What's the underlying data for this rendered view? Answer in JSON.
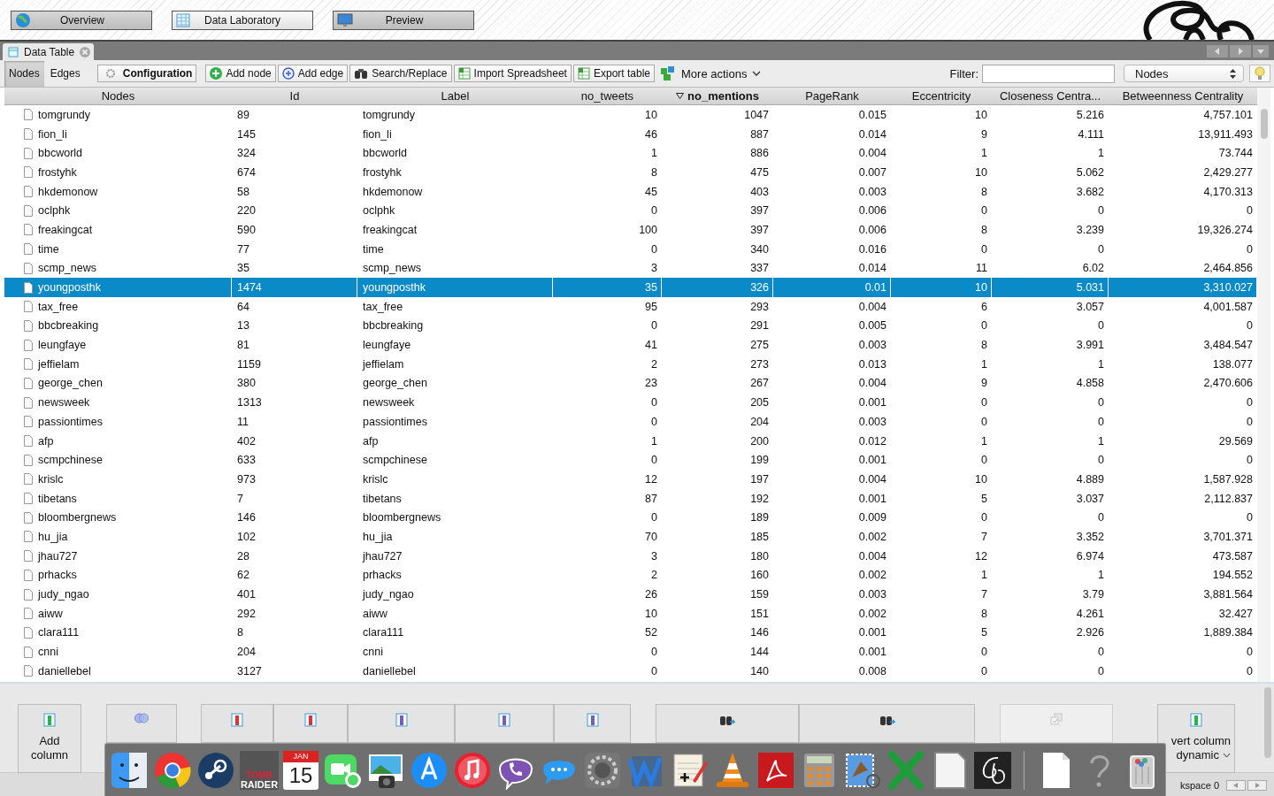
{
  "perspectives": [
    {
      "label": "Overview",
      "selected": false
    },
    {
      "label": "Data Laboratory",
      "selected": true
    },
    {
      "label": "Preview",
      "selected": false
    }
  ],
  "panel_tab": {
    "title": "Data Table"
  },
  "view_tabs": [
    {
      "label": "Nodes",
      "selected": true
    },
    {
      "label": "Edges",
      "selected": false
    }
  ],
  "toolbar": {
    "configuration": "Configuration",
    "actions": [
      "Add node",
      "Add edge",
      "Search/Replace",
      "Import Spreadsheet",
      "Export table"
    ],
    "more_actions": "More actions",
    "filter_label": "Filter:",
    "table_select": "Nodes"
  },
  "table": {
    "columns": [
      {
        "label": "Nodes",
        "kind": "text",
        "sorted": false
      },
      {
        "label": "Id",
        "kind": "text",
        "sorted": false
      },
      {
        "label": "Label",
        "kind": "text",
        "sorted": false
      },
      {
        "label": "no_tweets",
        "kind": "number",
        "sorted": false
      },
      {
        "label": "no_mentions",
        "kind": "number",
        "sorted": true
      },
      {
        "label": "PageRank",
        "kind": "number",
        "sorted": false
      },
      {
        "label": "Eccentricity",
        "kind": "number",
        "sorted": false
      },
      {
        "label": "Closeness Centra...",
        "kind": "number",
        "sorted": false
      },
      {
        "label": "Betweenness Centrality",
        "kind": "number",
        "sorted": false
      }
    ],
    "rows": [
      {
        "selected": false,
        "cells": [
          "tomgrundy",
          "89",
          "tomgrundy",
          "10",
          "1047",
          "0.015",
          "10",
          "5.216",
          "4,757.101"
        ]
      },
      {
        "selected": false,
        "cells": [
          "fion_li",
          "145",
          "fion_li",
          "46",
          "887",
          "0.014",
          "9",
          "4.111",
          "13,911.493"
        ]
      },
      {
        "selected": false,
        "cells": [
          "bbcworld",
          "324",
          "bbcworld",
          "1",
          "886",
          "0.004",
          "1",
          "1",
          "73.744"
        ]
      },
      {
        "selected": false,
        "cells": [
          "frostyhk",
          "674",
          "frostyhk",
          "8",
          "475",
          "0.007",
          "10",
          "5.062",
          "2,429.277"
        ]
      },
      {
        "selected": false,
        "cells": [
          "hkdemonow",
          "58",
          "hkdemonow",
          "45",
          "403",
          "0.003",
          "8",
          "3.682",
          "4,170.313"
        ]
      },
      {
        "selected": false,
        "cells": [
          "oclphk",
          "220",
          "oclphk",
          "0",
          "397",
          "0.006",
          "0",
          "0",
          "0"
        ]
      },
      {
        "selected": false,
        "cells": [
          "freakingcat",
          "590",
          "freakingcat",
          "100",
          "397",
          "0.006",
          "8",
          "3.239",
          "19,326.274"
        ]
      },
      {
        "selected": false,
        "cells": [
          "time",
          "77",
          "time",
          "0",
          "340",
          "0.016",
          "0",
          "0",
          "0"
        ]
      },
      {
        "selected": false,
        "cells": [
          "scmp_news",
          "35",
          "scmp_news",
          "3",
          "337",
          "0.014",
          "11",
          "6.02",
          "2,464.856"
        ]
      },
      {
        "selected": true,
        "cells": [
          "youngposthk",
          "1474",
          "youngposthk",
          "35",
          "326",
          "0.01",
          "10",
          "5.031",
          "3,310.027"
        ]
      },
      {
        "selected": false,
        "cells": [
          "tax_free",
          "64",
          "tax_free",
          "95",
          "293",
          "0.004",
          "6",
          "3.057",
          "4,001.587"
        ]
      },
      {
        "selected": false,
        "cells": [
          "bbcbreaking",
          "13",
          "bbcbreaking",
          "0",
          "291",
          "0.005",
          "0",
          "0",
          "0"
        ]
      },
      {
        "selected": false,
        "cells": [
          "leungfaye",
          "81",
          "leungfaye",
          "41",
          "275",
          "0.003",
          "8",
          "3.991",
          "3,484.547"
        ]
      },
      {
        "selected": false,
        "cells": [
          "jeffielam",
          "1159",
          "jeffielam",
          "2",
          "273",
          "0.013",
          "1",
          "1",
          "138.077"
        ]
      },
      {
        "selected": false,
        "cells": [
          "george_chen",
          "380",
          "george_chen",
          "23",
          "267",
          "0.004",
          "9",
          "4.858",
          "2,470.606"
        ]
      },
      {
        "selected": false,
        "cells": [
          "newsweek",
          "1313",
          "newsweek",
          "0",
          "205",
          "0.001",
          "0",
          "0",
          "0"
        ]
      },
      {
        "selected": false,
        "cells": [
          "passiontimes",
          "11",
          "passiontimes",
          "0",
          "204",
          "0.003",
          "0",
          "0",
          "0"
        ]
      },
      {
        "selected": false,
        "cells": [
          "afp",
          "402",
          "afp",
          "1",
          "200",
          "0.012",
          "1",
          "1",
          "29.569"
        ]
      },
      {
        "selected": false,
        "cells": [
          "scmpchinese",
          "633",
          "scmpchinese",
          "0",
          "199",
          "0.001",
          "0",
          "0",
          "0"
        ]
      },
      {
        "selected": false,
        "cells": [
          "krislc",
          "973",
          "krislc",
          "12",
          "197",
          "0.004",
          "10",
          "4.889",
          "1,587.928"
        ]
      },
      {
        "selected": false,
        "cells": [
          "tibetans",
          "7",
          "tibetans",
          "87",
          "192",
          "0.001",
          "5",
          "3.037",
          "2,112.837"
        ]
      },
      {
        "selected": false,
        "cells": [
          "bloombergnews",
          "146",
          "bloombergnews",
          "0",
          "189",
          "0.009",
          "0",
          "0",
          "0"
        ]
      },
      {
        "selected": false,
        "cells": [
          "hu_jia",
          "102",
          "hu_jia",
          "70",
          "185",
          "0.002",
          "7",
          "3.352",
          "3,701.371"
        ]
      },
      {
        "selected": false,
        "cells": [
          "jhau727",
          "28",
          "jhau727",
          "3",
          "180",
          "0.004",
          "12",
          "6.974",
          "473.587"
        ]
      },
      {
        "selected": false,
        "cells": [
          "prhacks",
          "62",
          "prhacks",
          "2",
          "160",
          "0.002",
          "1",
          "1",
          "194.552"
        ]
      },
      {
        "selected": false,
        "cells": [
          "judy_ngao",
          "401",
          "judy_ngao",
          "26",
          "159",
          "0.003",
          "7",
          "3.79",
          "3,881.564"
        ]
      },
      {
        "selected": false,
        "cells": [
          "aiww",
          "292",
          "aiww",
          "10",
          "151",
          "0.002",
          "8",
          "4.261",
          "32.427"
        ]
      },
      {
        "selected": false,
        "cells": [
          "clara111",
          "8",
          "clara111",
          "52",
          "146",
          "0.001",
          "5",
          "2.926",
          "1,889.384"
        ]
      },
      {
        "selected": false,
        "cells": [
          "cnni",
          "204",
          "cnni",
          "0",
          "144",
          "0.001",
          "0",
          "0",
          "0"
        ]
      },
      {
        "selected": false,
        "cells": [
          "daniellebel",
          "3127",
          "daniellebel",
          "0",
          "140",
          "0.008",
          "0",
          "0",
          "0"
        ]
      }
    ]
  },
  "column_buttons": [
    {
      "lines": [
        "Add",
        "column"
      ],
      "disabled": false
    },
    {
      "disabled": false
    },
    {
      "disabled": false
    },
    {
      "disabled": false
    },
    {
      "disabled": false
    },
    {
      "disabled": false
    },
    {
      "disabled": false
    },
    {
      "disabled": false
    },
    {
      "disabled": false
    },
    {
      "disabled": true
    },
    {
      "lines": [
        "vert column",
        "dynamic"
      ],
      "disabled": false
    }
  ],
  "dock": {
    "game_title": [
      "TOMB",
      "RAIDER"
    ],
    "calendar_month": "JAN",
    "calendar_day": "15"
  },
  "status_bar": {
    "workspace": "kspace 0"
  }
}
